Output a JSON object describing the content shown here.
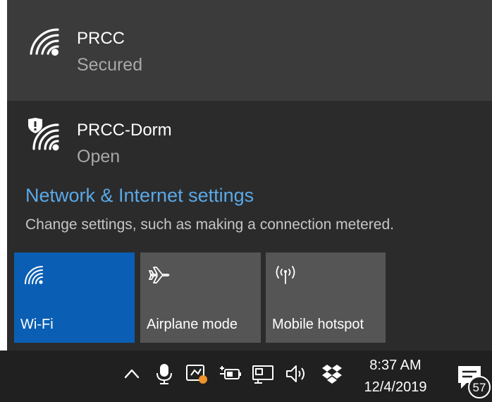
{
  "networks": [
    {
      "name": "PRCC",
      "status": "Secured",
      "icon": "wifi-secured-icon",
      "selected": true
    },
    {
      "name": "PRCC-Dorm",
      "status": "Open",
      "icon": "wifi-open-shield-icon",
      "selected": false
    }
  ],
  "settings": {
    "link": "Network & Internet settings",
    "description": "Change settings, such as making a connection metered."
  },
  "tiles": [
    {
      "label": "Wi-Fi",
      "icon": "wifi-icon",
      "active": true
    },
    {
      "label": "Airplane mode",
      "icon": "airplane-icon",
      "active": false
    },
    {
      "label": "Mobile hotspot",
      "icon": "hotspot-icon",
      "active": false
    }
  ],
  "taskbar": {
    "time": "8:37 AM",
    "date": "12/4/2019",
    "notification_count": "57",
    "tray_icons": [
      "chevron-up-icon",
      "microphone-icon",
      "app-tray-icon",
      "battery-plug-icon",
      "network-monitor-icon",
      "volume-icon",
      "dropbox-icon"
    ]
  },
  "colors": {
    "flyout_bg": "#2b2b2b",
    "selected_bg": "#3b3b3b",
    "accent": "#0a5fb4",
    "link": "#5aa9e8",
    "tile_bg": "#555555",
    "taskbar_bg": "#202020"
  }
}
